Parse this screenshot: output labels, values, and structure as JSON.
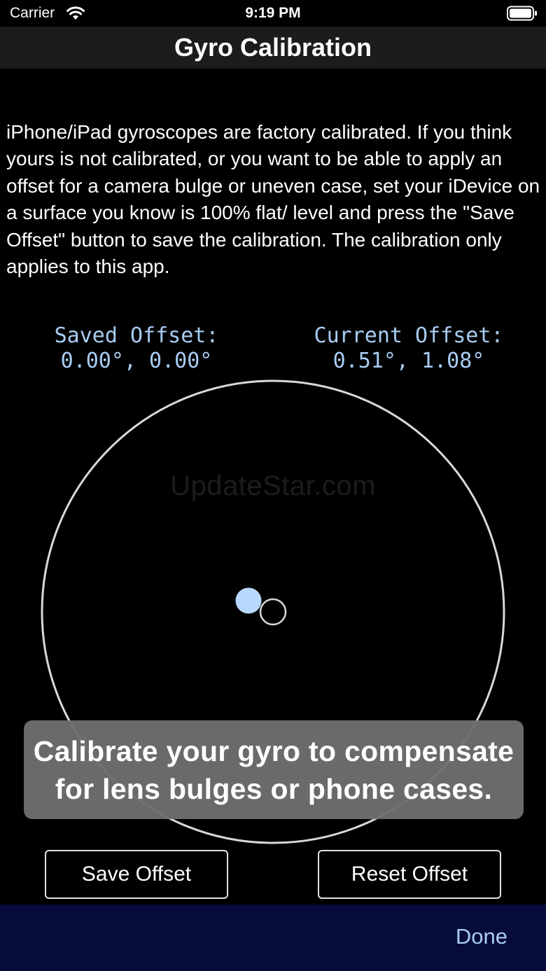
{
  "status_bar": {
    "carrier": "Carrier",
    "time": "9:19 PM",
    "wifi_icon": "wifi-icon",
    "battery_icon": "battery-icon"
  },
  "nav": {
    "title": "Gyro Calibration"
  },
  "description": "iPhone/iPad gyroscopes are factory calibrated. If you think yours is not calibrated, or you want to be able to apply an offset for a camera bulge or uneven case, set your iDevice on a surface you know is 100% flat/ level and press the \"Save Offset\" button to save the calibration. The calibration only applies to this app.",
  "offsets": {
    "saved_label": "Saved Offset:",
    "saved_value": "0.00°, 0.00°",
    "current_label": "Current Offset:",
    "current_value": "0.51°, 1.08°"
  },
  "watermark": "UpdateStar.com",
  "banner": {
    "line1": "Calibrate your gyro to compensate",
    "line2": "for lens bulges or phone cases."
  },
  "buttons": {
    "save_label": "Save Offset",
    "reset_label": "Reset Offset",
    "done_label": "Done"
  },
  "colors": {
    "accent": "#a9cdf2",
    "nav_background": "#1c1c1c",
    "bottom_bar": "#070b3a",
    "banner": "#6e6e6e"
  }
}
